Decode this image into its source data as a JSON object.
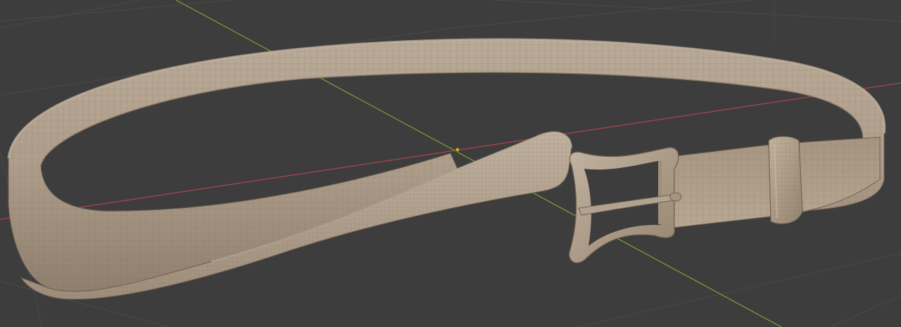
{
  "viewport": {
    "background_color": "#3d3d3d",
    "grid_line_color": "#4a4a4a",
    "x_axis_color": "#b0444f",
    "y_axis_color": "#7da431"
  },
  "model": {
    "object": "belt",
    "parts": [
      "strap",
      "tongue-end",
      "buckle-frame",
      "buckle-prong",
      "belt-loop"
    ],
    "material_color": "#ae9d8a",
    "shading": "solid",
    "wireframe_overlay": true
  },
  "origin_marker_icon": "origin-dot-icon"
}
